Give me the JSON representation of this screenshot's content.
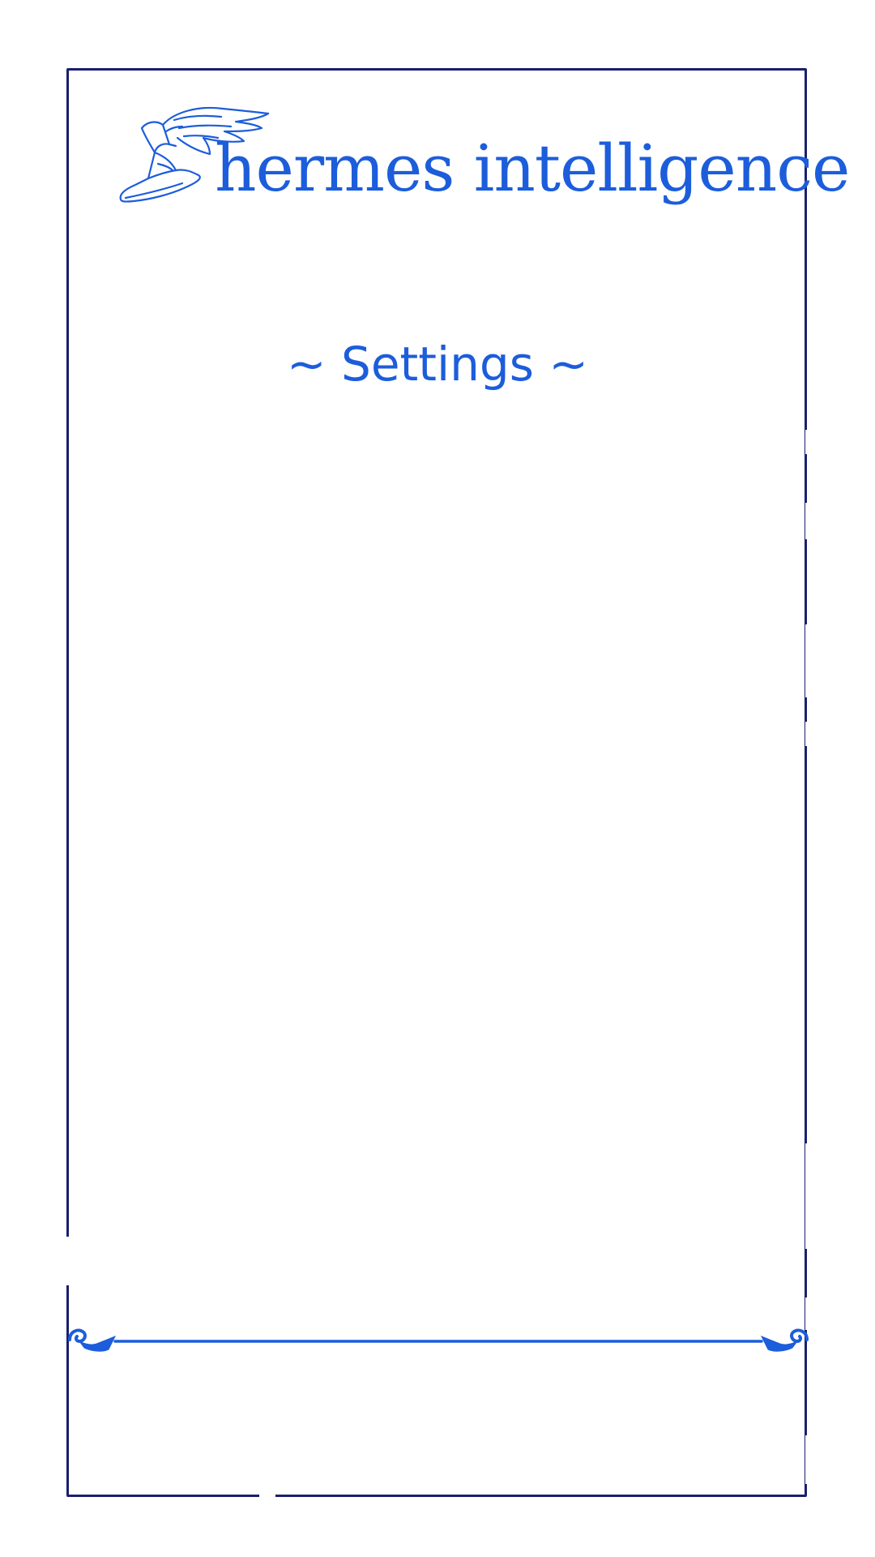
{
  "brand": {
    "name": "hermes intelligence",
    "logo_icon": "winged-sandal-icon",
    "color": "#1c5ddb"
  },
  "page": {
    "title": "~ Settings ~"
  },
  "frame": {
    "color": "#1a1f6e"
  },
  "divider": {
    "icon": "ornamental-flourish-divider",
    "color": "#1c5ddb"
  }
}
